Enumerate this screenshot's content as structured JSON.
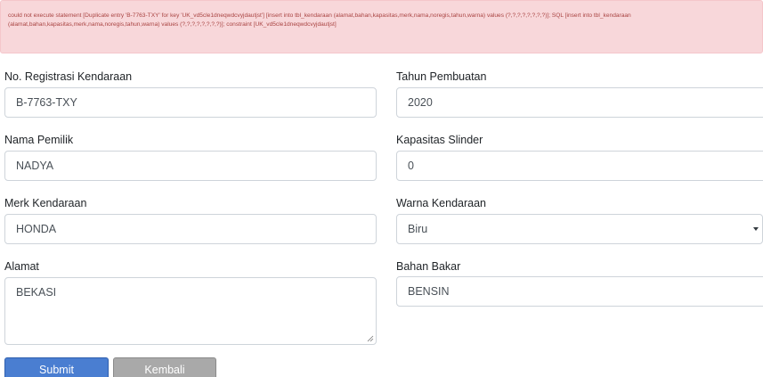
{
  "alert": {
    "message": "could not execute statement [Duplicate entry 'B-7763-TXY' for key 'UK_vd5cle1dneqwdcvyjdautjst'] [insert into tbl_kendaraan (alamat,bahan,kapasitas,merk,nama,noregis,tahun,warna) values (?,?,?,?,?,?,?,?)]; SQL [insert into tbl_kendaraan (alamat,bahan,kapasitas,merk,nama,noregis,tahun,warna) values (?,?,?,?,?,?,?,?)]; constraint [UK_vd5cle1dneqwdcvyjdautjst]",
    "color": "#a94442",
    "background": "#f8d7da"
  },
  "form": {
    "noregis": {
      "label": "No. Registrasi Kendaraan",
      "value": "B-7763-TXY"
    },
    "nama": {
      "label": "Nama Pemilik",
      "value": "NADYA"
    },
    "merk": {
      "label": "Merk Kendaraan",
      "value": "HONDA"
    },
    "alamat": {
      "label": "Alamat",
      "value": "BEKASI"
    },
    "tahun": {
      "label": "Tahun Pembuatan",
      "value": "2020"
    },
    "kapasitas": {
      "label": "Kapasitas Slinder",
      "value": "0"
    },
    "warna": {
      "label": "Warna Kendaraan",
      "value": "Biru"
    },
    "bahan": {
      "label": "Bahan Bakar",
      "value": "BENSIN"
    }
  },
  "buttons": {
    "submit": {
      "label": "Submit",
      "color": "#4a7ed1"
    },
    "back": {
      "label": "Kembali",
      "color": "#a9a9a9"
    }
  },
  "icons": {
    "select_arrow": "chevron-down-icon",
    "resize": "resize-grip-icon"
  }
}
